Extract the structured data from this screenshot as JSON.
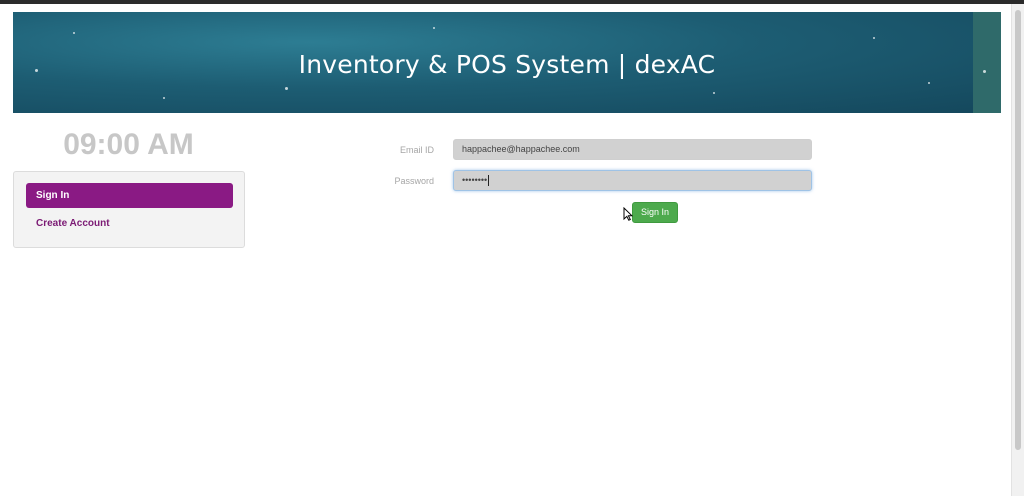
{
  "header": {
    "title": "Inventory & POS System | dexAC"
  },
  "clock": {
    "time": "09:00 AM"
  },
  "sidebar": {
    "items": [
      {
        "label": "Sign In",
        "active": true
      },
      {
        "label": "Create Account",
        "active": false
      }
    ]
  },
  "form": {
    "email_label": "Email ID",
    "email_value": "happachee@happachee.com",
    "password_label": "Password",
    "password_value": "••••••••",
    "submit_label": "Sign In"
  },
  "colors": {
    "banner": "#1d5d73",
    "active_item": "#8a1a84",
    "link": "#7b1a74",
    "submit": "#4daa4d"
  },
  "icons": [
    "mouse-pointer-icon"
  ]
}
